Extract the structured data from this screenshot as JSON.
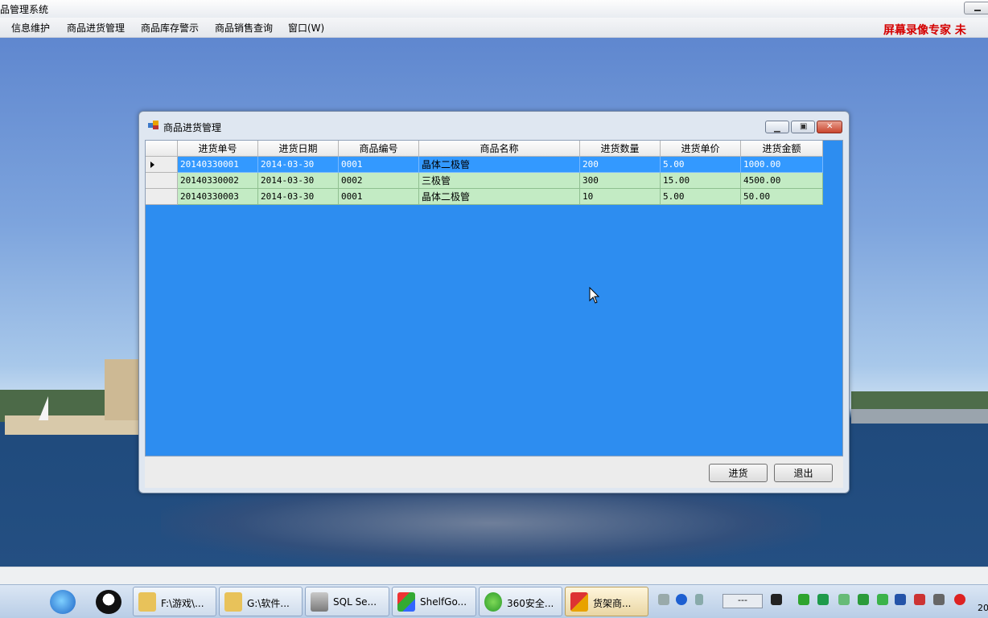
{
  "app": {
    "title": "品管理系统",
    "menu": [
      "信息维护",
      "商品进货管理",
      "商品库存警示",
      "商品销售查询",
      "窗口(W)"
    ],
    "watermark": "屏幕录像专家  未"
  },
  "dialog": {
    "title": "商品进货管理",
    "columns": [
      "进货单号",
      "进货日期",
      "商品编号",
      "商品名称",
      "进货数量",
      "进货单价",
      "进货金额"
    ],
    "rows": [
      [
        "20140330001",
        "2014-03-30",
        "0001",
        "晶体二极管",
        "200",
        "5.00",
        "1000.00"
      ],
      [
        "20140330002",
        "2014-03-30",
        "0002",
        "三极管",
        "300",
        "15.00",
        "4500.00"
      ],
      [
        "20140330003",
        "2014-03-30",
        "0001",
        "晶体二极管",
        "10",
        "5.00",
        "50.00"
      ]
    ],
    "selected_row": 0,
    "buttons": {
      "purchase": "进货",
      "exit": "退出"
    }
  },
  "taskbar": {
    "items": [
      "F:\\游戏\\...",
      "G:\\软件...",
      "SQL Se...",
      "ShelfGo...",
      "360安全...",
      "货架商..."
    ],
    "tray_text": "---",
    "clock_partial": "20"
  },
  "colors": {
    "grid_background": "#2d8df0",
    "row_background": "#c3ebc4",
    "selected_row": "#3399ff",
    "watermark": "#d40000"
  }
}
